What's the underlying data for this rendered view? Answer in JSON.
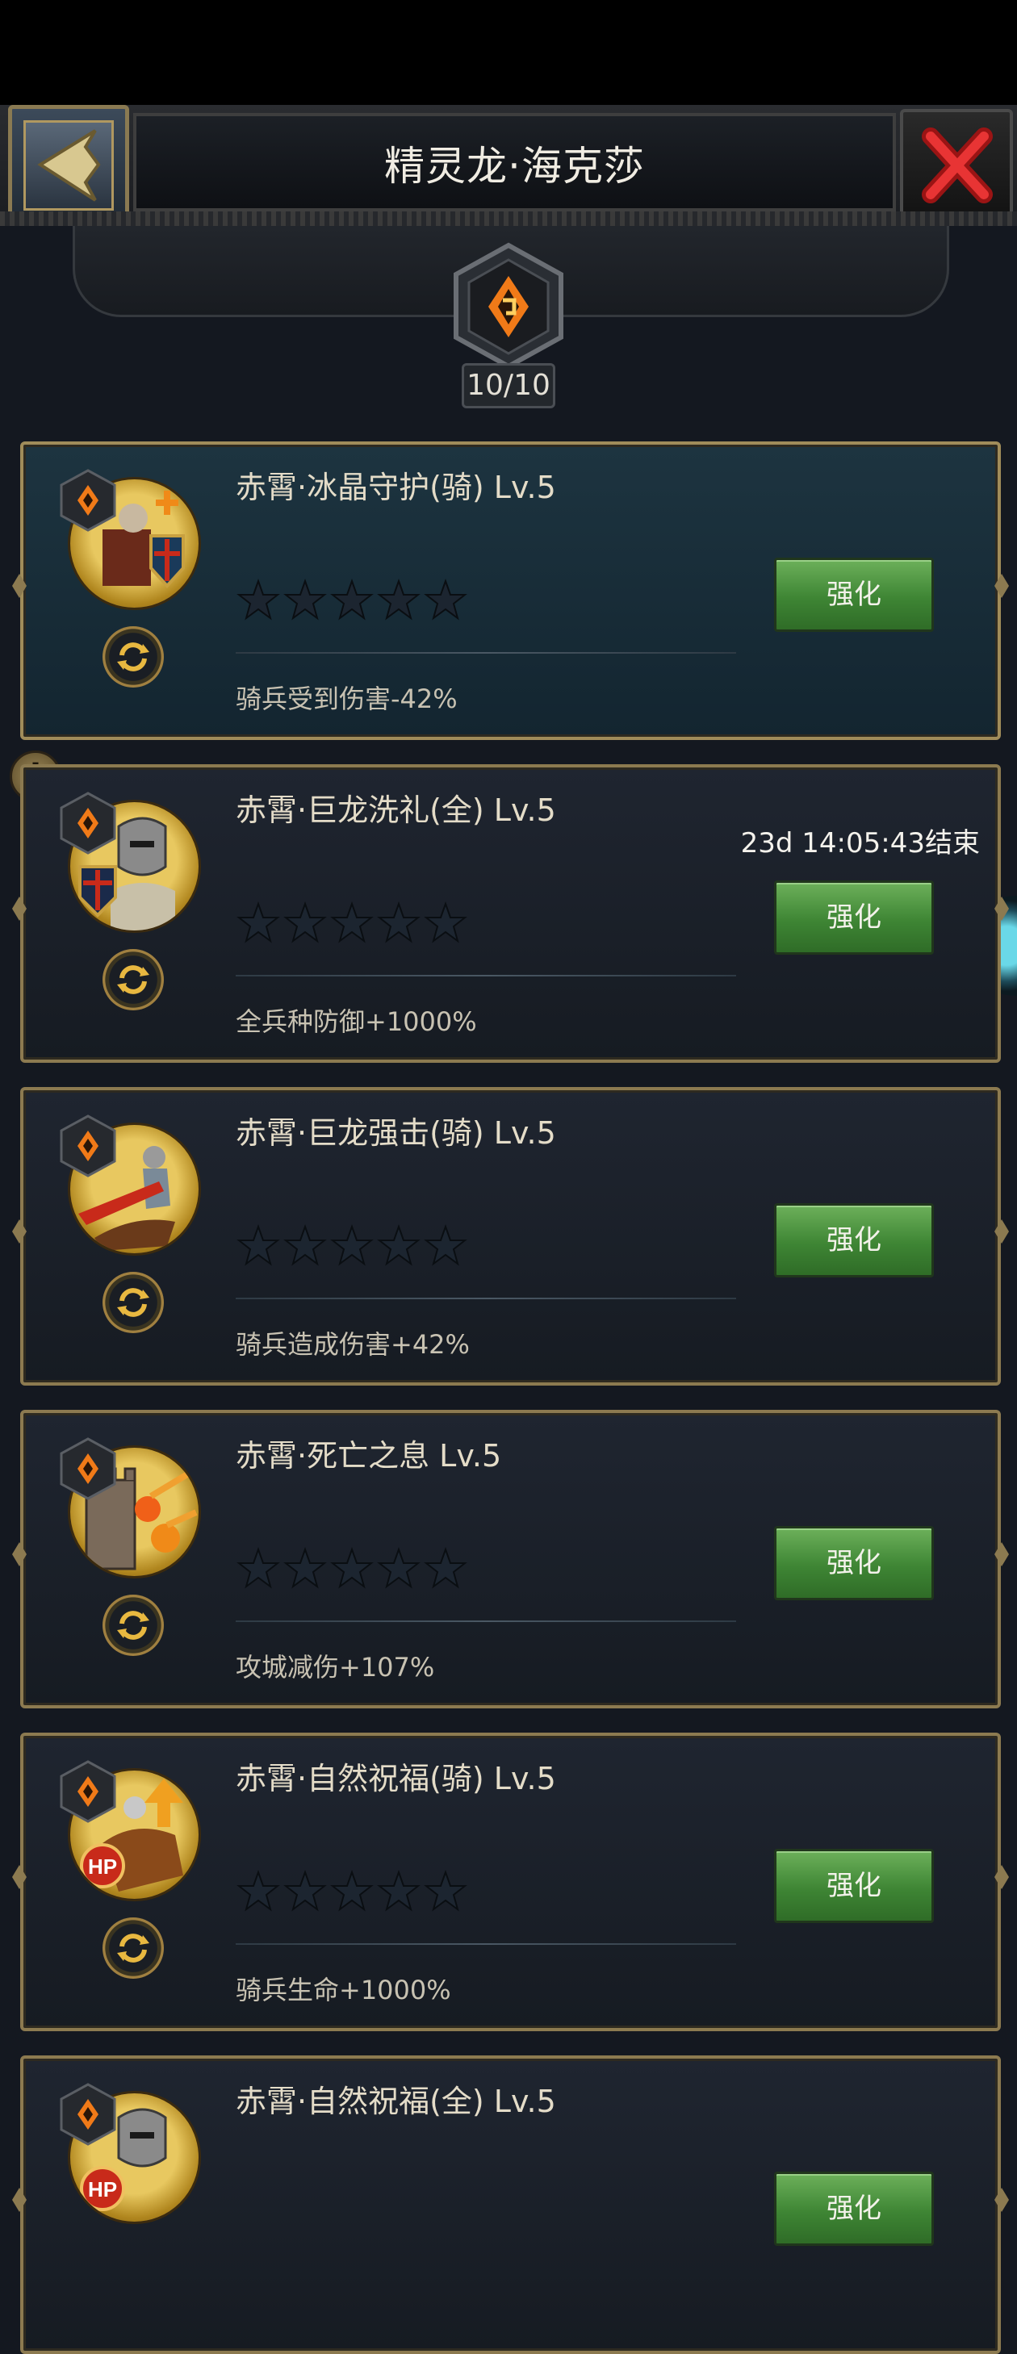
{
  "header": {
    "title": "精灵龙·海克莎",
    "back_icon": "back-arrow-icon",
    "close_icon": "close-x-icon"
  },
  "badge": {
    "icon": "flame-rune-icon",
    "count": "10/10"
  },
  "skills": [
    {
      "name": "赤霄·冰晶守护(骑) Lv.5",
      "stars": 0,
      "max_stars": 5,
      "button": "强化",
      "effect": "骑兵受到伤害-42%",
      "timer": ""
    },
    {
      "name": "赤霄·巨龙洗礼(全) Lv.5",
      "stars": 0,
      "max_stars": 5,
      "button": "强化",
      "effect": "全兵种防御+1000%",
      "timer": "23d 14:05:43结束"
    },
    {
      "name": "赤霄·巨龙强击(骑) Lv.5",
      "stars": 0,
      "max_stars": 5,
      "button": "强化",
      "effect": "骑兵造成伤害+42%",
      "timer": ""
    },
    {
      "name": "赤霄·死亡之息 Lv.5",
      "stars": 0,
      "max_stars": 5,
      "button": "强化",
      "effect": "攻城减伤+107%",
      "timer": ""
    },
    {
      "name": "赤霄·自然祝福(骑) Lv.5",
      "stars": 0,
      "max_stars": 5,
      "button": "强化",
      "effect": "骑兵生命+1000%",
      "timer": ""
    },
    {
      "name": "赤霄·自然祝福(全) Lv.5",
      "stars": 0,
      "max_stars": 5,
      "button": "强化",
      "effect": "",
      "timer": ""
    }
  ],
  "alert": {
    "symbol": "!"
  },
  "colors": {
    "button_green": "#3e8534",
    "gold_border": "#8c7a50",
    "background": "#141820"
  }
}
